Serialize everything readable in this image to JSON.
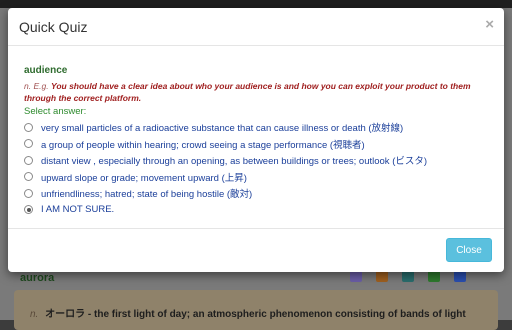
{
  "modal": {
    "title": "Quick Quiz",
    "close_symbol": "×",
    "word": "audience",
    "example_n": "n.",
    "example_label": "E.g.",
    "example_sentence": "You should have a clear idea about who your audience is and how you can exploit your product to them through the correct platform.",
    "select_label": "Select answer:",
    "options": [
      {
        "label": "very small particles of a radioactive substance that can cause illness or death (放射線)",
        "checked": false
      },
      {
        "label": "a group of people within hearing; crowd seeing a stage performance (視聴者)",
        "checked": false
      },
      {
        "label": "distant view , especially through an opening, as between buildings or trees; outlook (ビスタ)",
        "checked": false
      },
      {
        "label": "upward slope or grade; movement upward (上昇)",
        "checked": false
      },
      {
        "label": "unfriendliness; hatred; state of being hostile (敵対)",
        "checked": false
      },
      {
        "label": "I AM NOT SURE.",
        "checked": true
      }
    ],
    "close_button": "Close"
  },
  "background": {
    "word": "aurora",
    "entry_n": "n.",
    "entry_term": "オーロラ -",
    "entry_text": "the first light of day; an atmospheric phenomenon consisting of bands of light",
    "icons": [
      {
        "name": "speech-bubble-icon",
        "color": "#6b5ea8"
      },
      {
        "name": "calculator-icon",
        "color": "#a06020"
      },
      {
        "name": "pencil-icon",
        "color": "#2a6e6e"
      },
      {
        "name": "notebook-icon",
        "color": "#2e7a2e"
      },
      {
        "name": "speaker-icon",
        "color": "#2a4fb0"
      }
    ]
  }
}
